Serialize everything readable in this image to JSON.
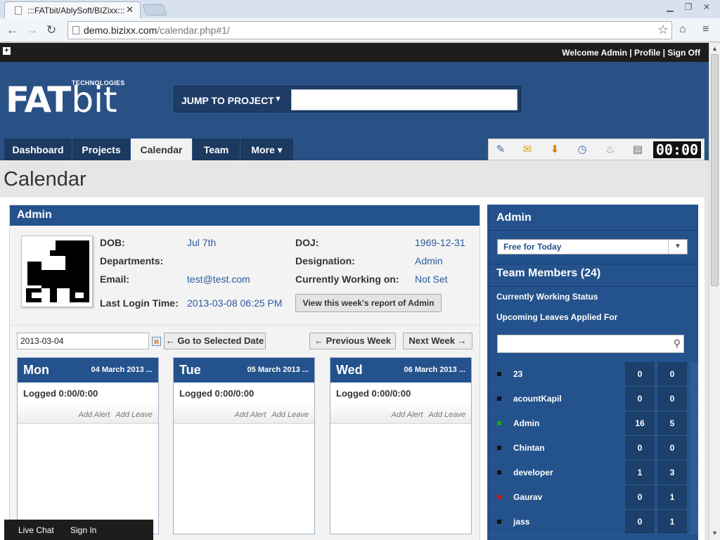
{
  "browser": {
    "tab_title": ":::FATbit/AblySoft/BIZixx:::",
    "tab_close": "✕",
    "url_host": "demo.bizixx.com",
    "url_path": "/calendar.php#1/"
  },
  "topbar": {
    "welcome": "Welcome Admin | Profile | Sign Off"
  },
  "header": {
    "logo_main": "FAT",
    "logo_bit": "bit",
    "logo_tagline": "TECHNOLOGIES",
    "jump_label": "JUMP TO PROJECT",
    "jump_value": ""
  },
  "nav": {
    "items": [
      {
        "label": "Dashboard",
        "active": false
      },
      {
        "label": "Projects",
        "active": false
      },
      {
        "label": "Calendar",
        "active": true
      },
      {
        "label": "Team",
        "active": false
      },
      {
        "label": "More ▾",
        "active": false
      }
    ]
  },
  "toolbar_icons": [
    "notes-icon",
    "mail-icon",
    "download-icon",
    "stopwatch-icon",
    "birthday-icon",
    "report-icon"
  ],
  "timer": "00:00",
  "page_title": "Calendar",
  "profile": {
    "name": "Admin",
    "dob_label": "DOB:",
    "dob": "Jul 7th",
    "doj_label": "DOJ:",
    "doj": "1969-12-31",
    "departments_label": "Departments:",
    "departments": "",
    "designation_label": "Designation:",
    "designation": "Admin",
    "email_label": "Email:",
    "email": "test@test.com",
    "working_label": "Currently Working on:",
    "working": "Not Set",
    "login_label": "Last Login Time:",
    "login": "2013-03-08 06:25 PM",
    "report_button": "View this week's report of Admin"
  },
  "week_nav": {
    "selected_date": "2013-03-04",
    "go_button": "← Go to Selected Date",
    "prev_button": "← Previous Week",
    "next_button": "Next Week →"
  },
  "days": [
    {
      "name": "Mon",
      "date": "04 March 2013 ...",
      "logged": "Logged 0:00/0:00",
      "add_alert": "Add Alert",
      "add_leave": "Add Leave"
    },
    {
      "name": "Tue",
      "date": "05 March 2013 ...",
      "logged": "Logged 0:00/0:00",
      "add_alert": "Add Alert",
      "add_leave": "Add Leave"
    },
    {
      "name": "Wed",
      "date": "06 March 2013 ...",
      "logged": "Logged 0:00/0:00",
      "add_alert": "Add Alert",
      "add_leave": "Add Leave"
    }
  ],
  "team": {
    "title": "Admin",
    "status_select": "Free for Today",
    "members_title": "Team Members (24)",
    "link_working": "Currently Working Status",
    "link_leaves": "Upcoming Leaves Applied For",
    "search_value": "",
    "members": [
      {
        "name": "23",
        "a": "0",
        "b": "0",
        "status_color": "#111111"
      },
      {
        "name": "acountKapil",
        "a": "0",
        "b": "0",
        "status_color": "#111111"
      },
      {
        "name": "Admin",
        "a": "16",
        "b": "5",
        "status_color": "#1aa31a"
      },
      {
        "name": "Chintan",
        "a": "0",
        "b": "0",
        "status_color": "#111111"
      },
      {
        "name": "developer",
        "a": "1",
        "b": "3",
        "status_color": "#111111"
      },
      {
        "name": "Gaurav",
        "a": "0",
        "b": "1",
        "status_color": "#d01818"
      },
      {
        "name": "jass",
        "a": "0",
        "b": "1",
        "status_color": "#111111"
      }
    ]
  },
  "footer": {
    "live_chat": "Live Chat",
    "sign_in": "Sign In"
  }
}
